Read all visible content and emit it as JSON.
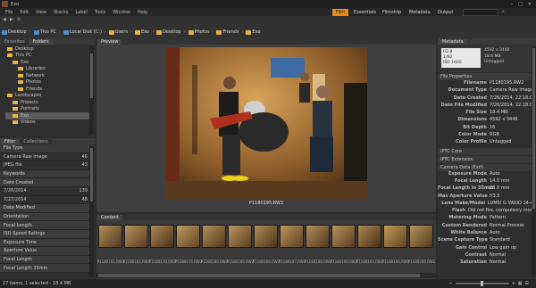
{
  "window": {
    "title": "Exo"
  },
  "menu": [
    "File",
    "Edit",
    "View",
    "Stacks",
    "Label",
    "Tools",
    "Window",
    "Help"
  ],
  "workspaces": [
    {
      "label": "Film",
      "active": true
    },
    {
      "label": "Essentials",
      "active": false
    },
    {
      "label": "Filmstrip",
      "active": false
    },
    {
      "label": "Metadata",
      "active": false
    },
    {
      "label": "Output",
      "active": false
    }
  ],
  "path": [
    "Desktop",
    "This PC",
    "Local Disk (C:)",
    "Users",
    "Exo",
    "Desktop",
    "Photos",
    "Friends",
    "Exo"
  ],
  "favorites_tabs": [
    "Favorites",
    "Folders"
  ],
  "folders": [
    {
      "label": "Desktop",
      "sel": false
    },
    {
      "label": "This PC",
      "sel": false
    },
    {
      "label": "Exo",
      "sel": false
    },
    {
      "label": "Libraries",
      "sel": false
    },
    {
      "label": "Network",
      "sel": false
    },
    {
      "label": "Photos",
      "sel": false
    },
    {
      "label": "Friends",
      "sel": false
    },
    {
      "label": "Landscapes",
      "sel": false
    },
    {
      "label": "Projects",
      "sel": false
    },
    {
      "label": "Portraits",
      "sel": false
    },
    {
      "label": "Exo",
      "sel": true
    },
    {
      "label": "Videos",
      "sel": false
    }
  ],
  "filter_tabs": [
    "Filter",
    "Collections"
  ],
  "filters": [
    {
      "label": "File Type",
      "count": "",
      "cat": true
    },
    {
      "label": "Camera Raw image",
      "count": "46",
      "cat": false
    },
    {
      "label": "JPEG file",
      "count": "43",
      "cat": false
    },
    {
      "label": "Keywords",
      "count": "",
      "cat": true
    },
    {
      "label": "Date Created",
      "count": "",
      "cat": true
    },
    {
      "label": "7/26/2014",
      "count": "139",
      "cat": false
    },
    {
      "label": "7/27/2014",
      "count": "48",
      "cat": false
    },
    {
      "label": "Date Modified",
      "count": "",
      "cat": true
    },
    {
      "label": "Orientation",
      "count": "",
      "cat": true
    },
    {
      "label": "Focal Length",
      "count": "",
      "cat": true
    },
    {
      "label": "ISO Speed Ratings",
      "count": "",
      "cat": true
    },
    {
      "label": "Exposure Time",
      "count": "",
      "cat": true
    },
    {
      "label": "Aperture Value",
      "count": "",
      "cat": true
    },
    {
      "label": "Focal Length",
      "count": "",
      "cat": true
    },
    {
      "label": "Focal Length 35mm",
      "count": "",
      "cat": true
    }
  ],
  "preview": {
    "tab": "Preview",
    "caption": "P1180195.RW2"
  },
  "filmstrip": {
    "tab": "Content",
    "captions": [
      "P1180161.RW2",
      "P1180165.RW2",
      "P1180170.RW2",
      "P1180176.RW2",
      "P1180180.RW2",
      "P1180185.RW2",
      "P1180186.RW2",
      "P1180187.RW2",
      "P1180188.RW2",
      "P1180190.RW2",
      "P1180193.RW2",
      "P1180195.RW2",
      "P1180200.RW2"
    ],
    "selected_index": 11
  },
  "metadata": {
    "tab": "Metadata",
    "summary": {
      "ev": "f/2.8",
      "shutter": "1/60",
      "size": "4592 x 3448",
      "filesize": "18.4 MB",
      "iso": "ISO 1600",
      "color": "Untagged"
    },
    "file_props_title": "File Properties",
    "file_props": [
      {
        "k": "Filename",
        "v": "P1180195.RW2"
      },
      {
        "k": "Document Type",
        "v": "Camera Raw image"
      },
      {
        "k": "Date Created",
        "v": "7/26/2014, 22:18:05"
      },
      {
        "k": "Date File Modified",
        "v": "7/26/2014, 22:18:05"
      },
      {
        "k": "File Size",
        "v": "18.4 MB"
      },
      {
        "k": "Dimensions",
        "v": "4592 x 3448"
      },
      {
        "k": "Bit Depth",
        "v": "16"
      },
      {
        "k": "Color Mode",
        "v": "RGB"
      },
      {
        "k": "Color Profile",
        "v": "Untagged"
      }
    ],
    "sections": [
      "IPTC Core",
      "IPTC Extension"
    ],
    "camera_title": "Camera Data (Exif)",
    "camera": [
      {
        "k": "Exposure Mode",
        "v": "Auto"
      },
      {
        "k": "Focal Length",
        "v": "14.0 mm"
      },
      {
        "k": "Focal Length in 35mm",
        "v": "28.0 mm"
      },
      {
        "k": "Max Aperture Value",
        "v": "f/3.5"
      },
      {
        "k": "Lens Make/Model",
        "v": "LUMIX G VARIO 14-42"
      },
      {
        "k": "Flash",
        "v": "Did not fire, compulsory mode"
      },
      {
        "k": "Metering Mode",
        "v": "Pattern"
      },
      {
        "k": "Custom Rendered",
        "v": "Normal Process"
      },
      {
        "k": "White Balance",
        "v": "Auto"
      },
      {
        "k": "Scene Capture Type",
        "v": "Standard"
      },
      {
        "k": "Gain Control",
        "v": "Low gain up"
      },
      {
        "k": "Contrast",
        "v": "Normal"
      },
      {
        "k": "Saturation",
        "v": "Normal"
      }
    ]
  },
  "status": {
    "text": "27 items, 1 selected - 18.4 MB"
  }
}
